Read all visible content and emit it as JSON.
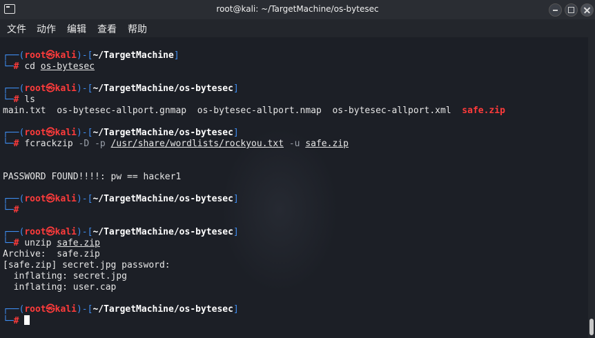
{
  "window": {
    "title": "root@kali: ~/TargetMachine/os-bytesec",
    "menu": [
      "文件",
      "动作",
      "编辑",
      "查看",
      "帮助"
    ]
  },
  "prompt": {
    "user": "root",
    "host": "kali",
    "at": "㉿"
  },
  "blocks": [
    {
      "dir": "~/TargetMachine",
      "command": "cd",
      "args": "os-bytesec"
    },
    {
      "dir": "~/TargetMachine/os-bytesec",
      "command": "ls",
      "output_files": [
        "main.txt",
        "os-bytesec-allport.gnmap",
        "os-bytesec-allport.nmap",
        "os-bytesec-allport.xml"
      ],
      "output_highlight": "safe.zip"
    },
    {
      "dir": "~/TargetMachine/os-bytesec",
      "command": "fcrackzip",
      "flags": "-D -p",
      "wordlist": "/usr/share/wordlists/rockyou.txt",
      "flag_u": "-u",
      "target": "safe.zip",
      "output": "PASSWORD FOUND!!!!: pw == hacker1"
    },
    {
      "dir": "~/TargetMachine/os-bytesec",
      "command": ""
    },
    {
      "dir": "~/TargetMachine/os-bytesec",
      "command": "unzip",
      "args": "safe.zip",
      "output_lines": [
        "Archive:  safe.zip",
        "[safe.zip] secret.jpg password: ",
        "  inflating: secret.jpg",
        "  inflating: user.cap"
      ]
    },
    {
      "dir": "~/TargetMachine/os-bytesec",
      "command": ""
    }
  ],
  "colors": {
    "prompt_frame": "#3f8ef2",
    "user_host": "#ff3b3b",
    "highlight_file": "#ff3b3b"
  }
}
